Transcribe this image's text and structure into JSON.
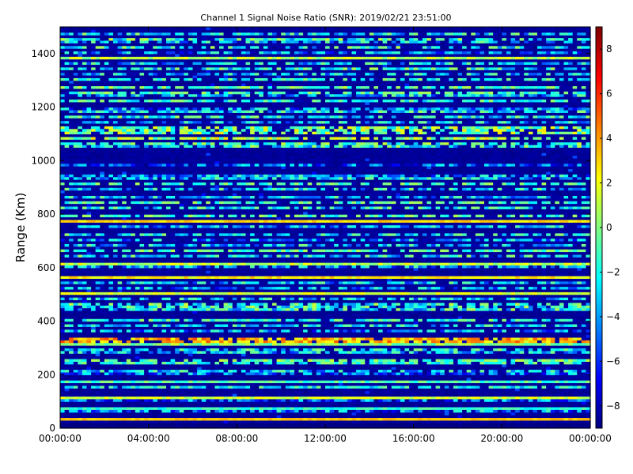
{
  "chart_data": {
    "type": "heatmap",
    "title": "Channel 1 Signal Noise Ratio (SNR): 2019/02/21 23:51:00",
    "xlabel": "",
    "ylabel": "Range (Km)",
    "x_ticks": [
      "00:00:00",
      "04:00:00",
      "08:00:00",
      "12:00:00",
      "16:00:00",
      "20:00:00",
      "00:00:00"
    ],
    "x_range": [
      "00:00:00",
      "24:00:00"
    ],
    "y_ticks": [
      0,
      200,
      400,
      600,
      800,
      1000,
      1200,
      1400
    ],
    "ylim": [
      0,
      1500
    ],
    "colorbar": {
      "colormap": "jet",
      "ticks": [
        -8,
        -6,
        -4,
        -2,
        0,
        2,
        4,
        6,
        8
      ],
      "range": [
        -9,
        9
      ]
    },
    "time_bins": 120,
    "range_bins": 150,
    "notes_visible": "Horizontal range-gate bands; strongest (yellow-orange, up to ~6) at ~330 Km; yellow bands at ~30, ~570, ~780 Km; cyan/green clusters near 1100-1130 and 1380 Km; background about -9.",
    "row_levels": [
      {
        "range_km": [
          0,
          20
        ],
        "level": -9,
        "var": 0.3
      },
      {
        "range_km": [
          30,
          40
        ],
        "level": 3.2,
        "var": 0.5
      },
      {
        "range_km": [
          60,
          70
        ],
        "level": -4,
        "var": 3
      },
      {
        "range_km": [
          70,
          80
        ],
        "level": -1.5,
        "var": 1.2
      },
      {
        "range_km": [
          100,
          110
        ],
        "level": -5,
        "var": 3
      },
      {
        "range_km": [
          115,
          125
        ],
        "level": 1.5,
        "var": 1
      },
      {
        "range_km": [
          150,
          160
        ],
        "level": -2,
        "var": 2
      },
      {
        "range_km": [
          175,
          185
        ],
        "level": -1,
        "var": 1.5
      },
      {
        "range_km": [
          200,
          210
        ],
        "level": -4.5,
        "var": 3
      },
      {
        "range_km": [
          215,
          225
        ],
        "level": -3,
        "var": 3
      },
      {
        "range_km": [
          240,
          250
        ],
        "level": -1.5,
        "var": 2
      },
      {
        "range_km": [
          255,
          265
        ],
        "level": -0.5,
        "var": 2
      },
      {
        "range_km": [
          280,
          290
        ],
        "level": -3,
        "var": 3
      },
      {
        "range_km": [
          295,
          305
        ],
        "level": -2,
        "var": 2.5
      },
      {
        "range_km": [
          310,
          320
        ],
        "level": 0,
        "var": 1.5
      },
      {
        "range_km": [
          325,
          340
        ],
        "level": 3.5,
        "var": 2
      },
      {
        "range_km": [
          365,
          375
        ],
        "level": -4,
        "var": 3
      },
      {
        "range_km": [
          385,
          395
        ],
        "level": -2.5,
        "var": 2.5
      },
      {
        "range_km": [
          400,
          410
        ],
        "level": -1.5,
        "var": 2
      },
      {
        "range_km": [
          440,
          450
        ],
        "level": -2,
        "var": 3
      },
      {
        "range_km": [
          455,
          470
        ],
        "level": -1.5,
        "var": 3
      },
      {
        "range_km": [
          480,
          490
        ],
        "level": -3,
        "var": 3
      },
      {
        "range_km": [
          500,
          510
        ],
        "level": 1.5,
        "var": 1
      },
      {
        "range_km": [
          525,
          535
        ],
        "level": -4,
        "var": 3
      },
      {
        "range_km": [
          540,
          550
        ],
        "level": -3,
        "var": 3
      },
      {
        "range_km": [
          565,
          575
        ],
        "level": 2.5,
        "var": 1
      },
      {
        "range_km": [
          600,
          610
        ],
        "level": -3.5,
        "var": 3
      },
      {
        "range_km": [
          615,
          625
        ],
        "level": 1.2,
        "var": 1.5
      },
      {
        "range_km": [
          640,
          650
        ],
        "level": -2.5,
        "var": 3
      },
      {
        "range_km": [
          660,
          670
        ],
        "level": -1,
        "var": 2
      },
      {
        "range_km": [
          680,
          690
        ],
        "level": -3,
        "var": 3
      },
      {
        "range_km": [
          700,
          710
        ],
        "level": -4,
        "var": 3
      },
      {
        "range_km": [
          720,
          730
        ],
        "level": -2,
        "var": 2.5
      },
      {
        "range_km": [
          750,
          760
        ],
        "level": -3.5,
        "var": 3
      },
      {
        "range_km": [
          775,
          785
        ],
        "level": 2.8,
        "var": 0.8
      },
      {
        "range_km": [
          790,
          800
        ],
        "level": -1,
        "var": 2
      },
      {
        "range_km": [
          825,
          835
        ],
        "level": -2,
        "var": 2.5
      },
      {
        "range_km": [
          840,
          850
        ],
        "level": -1,
        "var": 2
      },
      {
        "range_km": [
          860,
          870
        ],
        "level": -3,
        "var": 3
      },
      {
        "range_km": [
          890,
          900
        ],
        "level": -2.5,
        "var": 3
      },
      {
        "range_km": [
          910,
          920
        ],
        "level": -1,
        "var": 2
      },
      {
        "range_km": [
          930,
          940
        ],
        "level": -3,
        "var": 3
      },
      {
        "range_km": [
          945,
          955
        ],
        "level": -3.5,
        "var": 3
      },
      {
        "range_km": [
          980,
          990
        ],
        "level": -5,
        "var": 3
      },
      {
        "range_km": [
          1050,
          1060
        ],
        "level": -2,
        "var": 3
      },
      {
        "range_km": [
          1065,
          1075
        ],
        "level": -1,
        "var": 2.5
      },
      {
        "range_km": [
          1080,
          1095
        ],
        "level": 0.5,
        "var": 2.5
      },
      {
        "range_km": [
          1100,
          1130
        ],
        "level": 0,
        "var": 3
      },
      {
        "range_km": [
          1140,
          1150
        ],
        "level": -3,
        "var": 3
      },
      {
        "range_km": [
          1160,
          1170
        ],
        "level": -2,
        "var": 3
      },
      {
        "range_km": [
          1180,
          1190
        ],
        "level": -2.5,
        "var": 3
      },
      {
        "range_km": [
          1195,
          1205
        ],
        "level": -4,
        "var": 3
      },
      {
        "range_km": [
          1220,
          1230
        ],
        "level": -1.5,
        "var": 2
      },
      {
        "range_km": [
          1240,
          1250
        ],
        "level": -3,
        "var": 3
      },
      {
        "range_km": [
          1250,
          1260
        ],
        "level": -1,
        "var": 2
      },
      {
        "range_km": [
          1275,
          1285
        ],
        "level": -0.5,
        "var": 2
      },
      {
        "range_km": [
          1300,
          1310
        ],
        "level": -1.5,
        "var": 2
      },
      {
        "range_km": [
          1320,
          1330
        ],
        "level": -3,
        "var": 3
      },
      {
        "range_km": [
          1340,
          1350
        ],
        "level": -2,
        "var": 3
      },
      {
        "range_km": [
          1360,
          1370
        ],
        "level": -3,
        "var": 3
      },
      {
        "range_km": [
          1380,
          1395
        ],
        "level": 1,
        "var": 1.5
      },
      {
        "range_km": [
          1400,
          1410
        ],
        "level": -4,
        "var": 3
      },
      {
        "range_km": [
          1420,
          1430
        ],
        "level": -2,
        "var": 3
      },
      {
        "range_km": [
          1440,
          1450
        ],
        "level": -3,
        "var": 3
      },
      {
        "range_km": [
          1455,
          1465
        ],
        "level": -1.5,
        "var": 3
      },
      {
        "range_km": [
          1475,
          1485
        ],
        "level": -2.5,
        "var": 3
      }
    ]
  }
}
